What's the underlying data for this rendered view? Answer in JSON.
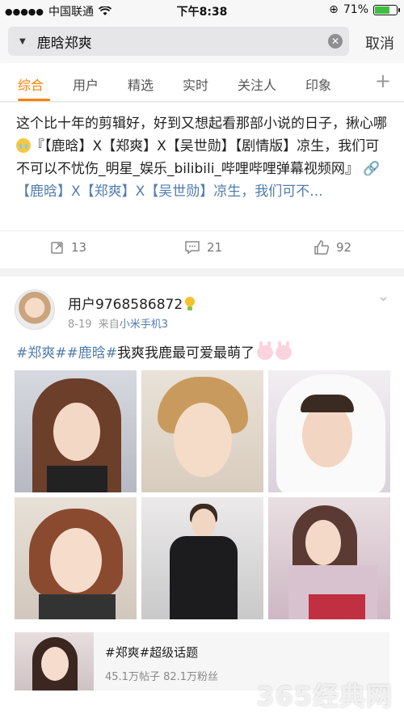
{
  "status_bar": {
    "carrier": "中国联通",
    "time": "下午8:38",
    "battery": "71%",
    "battery_level": 0.71
  },
  "search": {
    "query": "鹿晗郑爽",
    "cancel_label": "取消"
  },
  "tabs": [
    {
      "label": "综合",
      "active": true
    },
    {
      "label": "用户"
    },
    {
      "label": "精选"
    },
    {
      "label": "实时"
    },
    {
      "label": "关注人"
    },
    {
      "label": "印象"
    }
  ],
  "post1": {
    "text_a": "这个比十年的剪辑好，好到又想起看那部小说的日子，揪心哪",
    "text_b": "『【鹿晗】X【郑爽】X【吴世勋】【剧情版】凉生，我们可不可以不忧伤_明星_娱乐_bilibili_哔哩哔哩弹幕视频网』",
    "link_text": "【鹿晗】X【郑爽】X【吴世勋】凉生，我们可不...",
    "reposts": "13",
    "comments": "21",
    "likes": "92"
  },
  "post2": {
    "username": "用户9768586872",
    "date": "8-19",
    "source_prefix": "来自",
    "source": "小米手机3",
    "tags": "#郑爽##鹿晗#",
    "text": "我爽我鹿最可爱最萌了"
  },
  "topic_card": {
    "title": "#郑爽#超级话题",
    "stats": "45.1万帖子 82.1万粉丝"
  },
  "watermark": "365经典网"
}
